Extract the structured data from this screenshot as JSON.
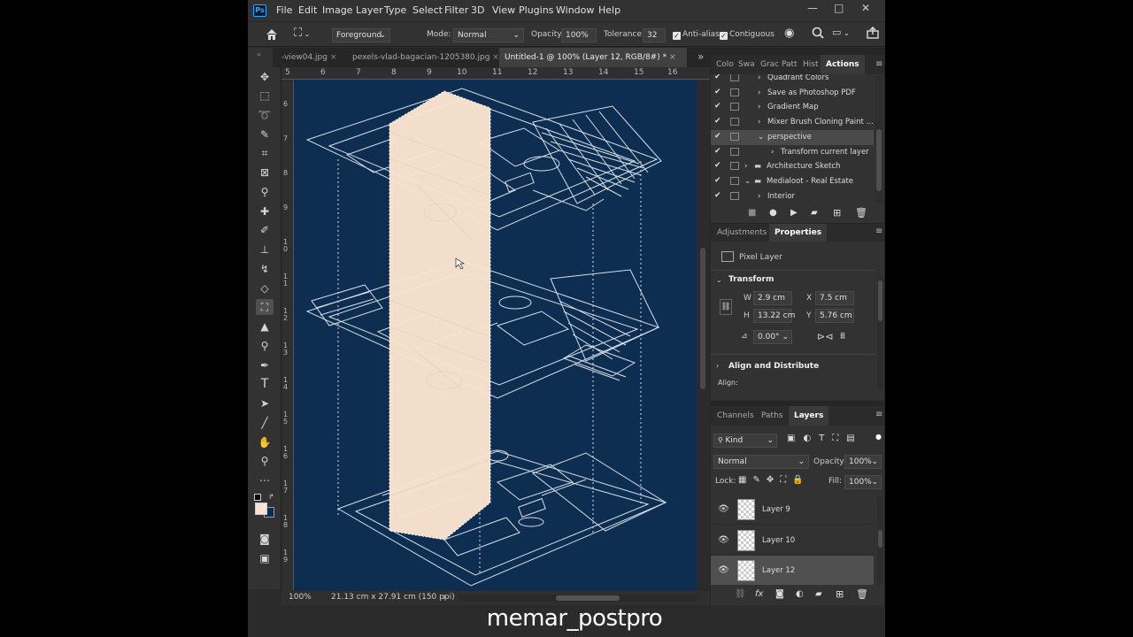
{
  "menu": [
    "File",
    "Edit",
    "Image",
    "Layer",
    "Type",
    "Select",
    "Filter",
    "3D",
    "View",
    "Plugins",
    "Window",
    "Help"
  ],
  "app_logo": "Ps",
  "window_controls": [
    "—",
    "□",
    "✕"
  ],
  "options": {
    "fill_source": "Foreground",
    "mode_label": "Mode:",
    "mode_value": "Normal",
    "opacity_label": "Opacity:",
    "opacity_value": "100%",
    "tolerance_label": "Tolerance:",
    "tolerance_value": "32",
    "antialias_label": "Anti-alias",
    "contiguous_label": "Contiguous"
  },
  "tabs": [
    {
      "label": "-view04.jpg",
      "close": "×",
      "active": false
    },
    {
      "label": "pexels-vlad-bagacian-1205380.jpg",
      "close": "×",
      "active": false
    },
    {
      "label": "Untitled-1 @ 100% (Layer 12, RGB/8#) *",
      "close": "×",
      "active": true
    }
  ],
  "tab_overflow": "»",
  "ruler_h": [
    "5",
    "6",
    "7",
    "8",
    "9",
    "10",
    "11",
    "12",
    "13",
    "14",
    "15",
    "16"
  ],
  "ruler_v": [
    "6",
    "7",
    "8",
    "9",
    "1\n0",
    "1\n1",
    "1\n2",
    "1\n3",
    "1\n4",
    "1\n5",
    "1\n6",
    "1\n7",
    "1\n8",
    "1\n9"
  ],
  "status": {
    "zoom": "100%",
    "doc_info": "21.13 cm x 27.91 cm (150 ppi)",
    "arrow": "›"
  },
  "watermark": "memar_postpro",
  "actions_panel": {
    "tabs": [
      "Colo",
      "Swa",
      "Grac",
      "Patt",
      "Hist",
      "Actions"
    ],
    "active_tab": "Actions",
    "rows": [
      {
        "label": "Quadrant Colors",
        "indent": 2,
        "folder": false,
        "expand": "›"
      },
      {
        "label": "Save as Photoshop PDF",
        "indent": 2,
        "folder": false,
        "expand": "›"
      },
      {
        "label": "Gradient Map",
        "indent": 2,
        "folder": false,
        "expand": "›"
      },
      {
        "label": "Mixer Brush Cloning Paint ...",
        "indent": 2,
        "folder": false,
        "expand": "›"
      },
      {
        "label": "perspective",
        "indent": 2,
        "folder": false,
        "expand": "⌄",
        "selected": true
      },
      {
        "label": "Transform current layer",
        "indent": 3,
        "folder": false,
        "expand": "›"
      },
      {
        "label": "Architecture Sketch",
        "indent": 1,
        "folder": true,
        "expand": "›"
      },
      {
        "label": "Medialoot - Real Estate",
        "indent": 1,
        "folder": true,
        "expand": "⌄"
      },
      {
        "label": "Interior",
        "indent": 2,
        "folder": false,
        "expand": "›"
      }
    ],
    "buttons": [
      "stop",
      "record",
      "play",
      "new-set",
      "new-action",
      "delete"
    ]
  },
  "properties_panel": {
    "tabs": [
      "Adjustments",
      "Properties"
    ],
    "active_tab": "Properties",
    "kind": "Pixel Layer",
    "transform_label": "Transform",
    "w_label": "W",
    "w_value": "2.9 cm",
    "x_label": "X",
    "x_value": "7.5 cm",
    "h_label": "H",
    "h_value": "13.22 cm",
    "y_label": "Y",
    "y_value": "5.76 cm",
    "angle_value": "0.00°",
    "align_label": "Align and Distribute",
    "align_sub": "Align:"
  },
  "layers_panel": {
    "tabs": [
      "Channels",
      "Paths",
      "Layers"
    ],
    "active_tab": "Layers",
    "kind_label": "Kind",
    "blend_mode": "Normal",
    "opacity_label": "Opacity:",
    "opacity_value": "100%",
    "lock_label": "Lock:",
    "fill_label": "Fill:",
    "fill_value": "100%",
    "layers": [
      {
        "name": "Layer 9",
        "selected": false
      },
      {
        "name": "Layer 10",
        "selected": false
      },
      {
        "name": "Layer 12",
        "selected": true
      }
    ],
    "footer_icons": [
      "link",
      "fx",
      "mask",
      "adjustment",
      "group",
      "new-layer",
      "delete"
    ]
  },
  "colors": {
    "foreground": "#fbe4cf",
    "background": "#0d2e50",
    "canvas_bg": "#0d2e50",
    "fill_overlay": "#fbe4cf"
  }
}
